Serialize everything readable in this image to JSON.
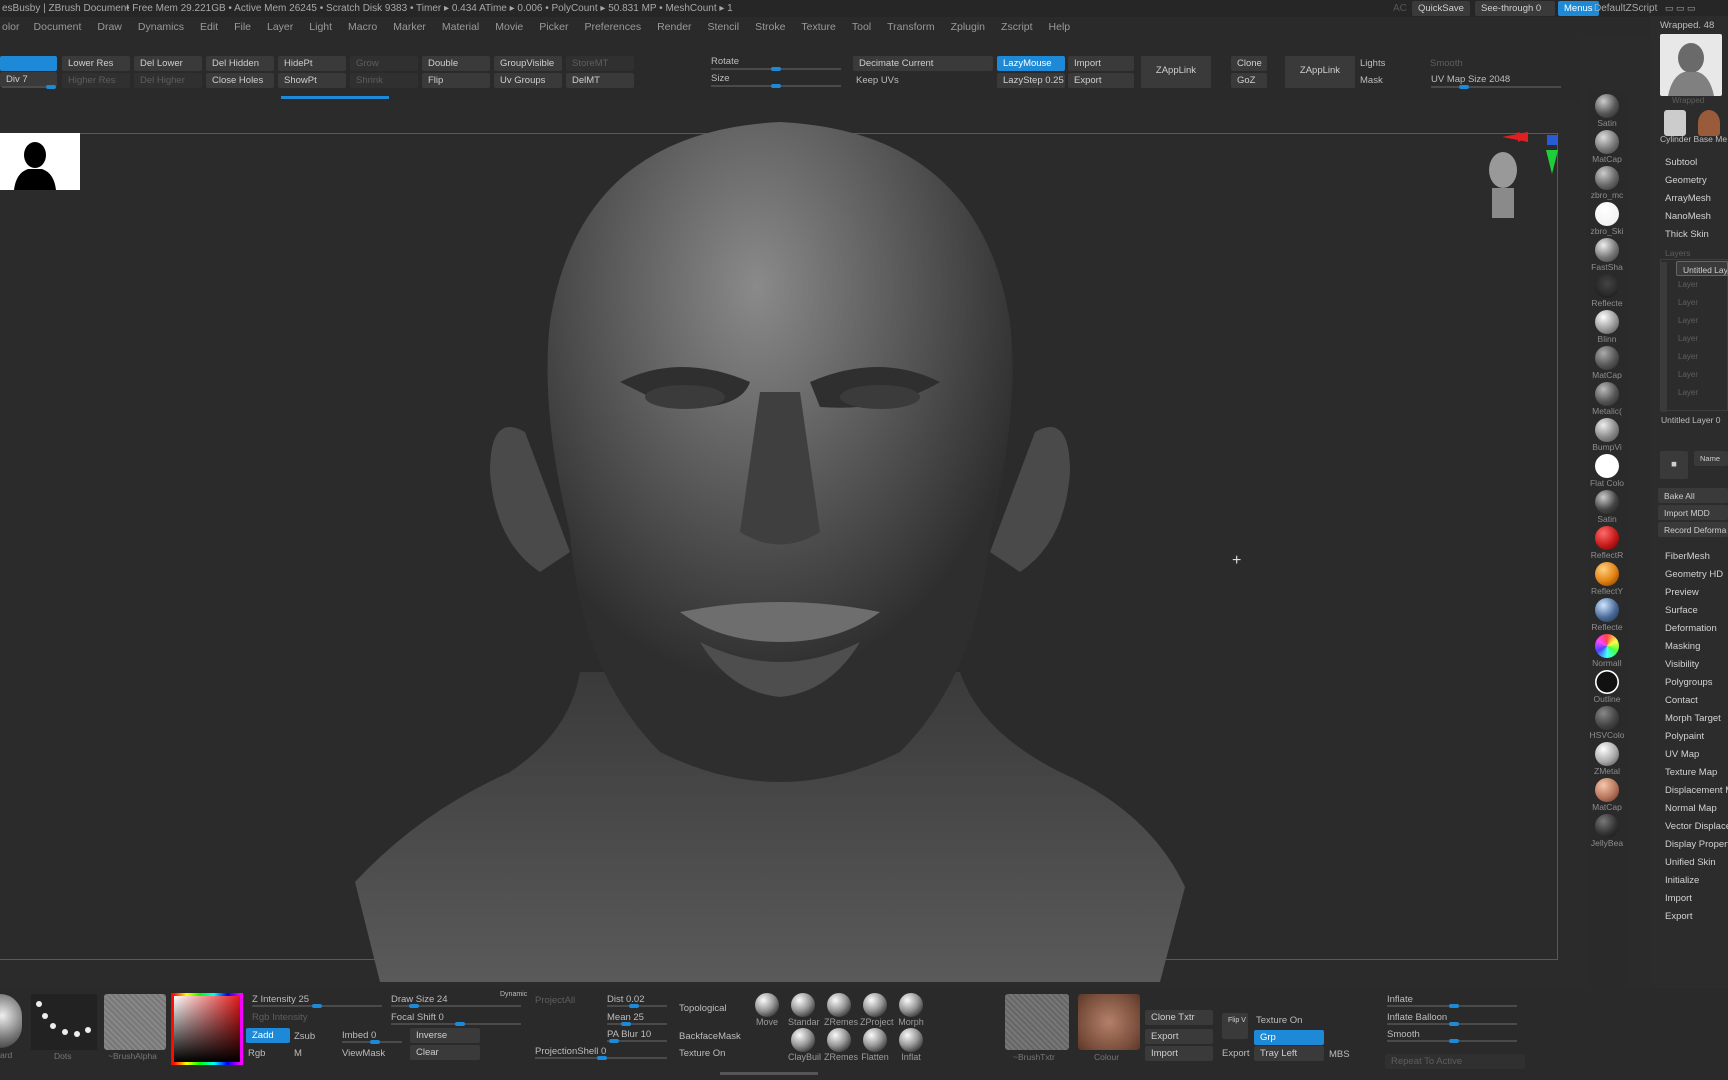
{
  "titlebar": {
    "doc": "esBusby |  ZBrush Document",
    "stats": "• Free Mem 29.221GB • Active Mem 26245 • Scratch Disk 9383 • Timer ▸ 0.434 ATime ▸ 0.006 • PolyCount ▸ 50.831 MP • MeshCount ▸ 1",
    "ac": "AC",
    "quicksave": "QuickSave",
    "seethrough": "See-through  0",
    "menus": "Menus",
    "script": "DefaultZScript"
  },
  "menubar": [
    "olor",
    "Document",
    "Draw",
    "Dynamics",
    "Edit",
    "File",
    "Layer",
    "Light",
    "Macro",
    "Marker",
    "Material",
    "Movie",
    "Picker",
    "Preferences",
    "Render",
    "Stencil",
    "Stroke",
    "Texture",
    "Tool",
    "Transform",
    "Zplugin",
    "Zscript",
    "Help"
  ],
  "topshelf": {
    "row1": [
      "Lower Res",
      "Del Lower",
      "Del Hidden",
      "HidePt",
      "Grow",
      "Double",
      "GroupVisible",
      "StoreMT"
    ],
    "row2": [
      "Higher Res",
      "Del Higher",
      "Close Holes",
      "ShowPt",
      "Shrink",
      "Flip",
      "Uv Groups",
      "DelMT"
    ],
    "div": "Div 7",
    "rotate": "Rotate",
    "size": "Size",
    "decimate": "Decimate Current",
    "keepuvs": "Keep UVs",
    "lazymouse": "LazyMouse",
    "lazystep": "LazyStep 0.25",
    "import": "Import",
    "export": "Export",
    "zapplink1": "ZAppLink",
    "clone": "Clone",
    "goz": "GoZ",
    "zapplink2": "ZAppLink",
    "lights": "Lights",
    "mask": "Mask",
    "smooth": "Smooth",
    "uvmapsize": "UV Map Size 2048"
  },
  "materials": [
    "Satin",
    "MatCap",
    "zbro_mc",
    "zbro_Ski",
    "FastSha",
    "Reflecte",
    "Blinn",
    "MatCap",
    "Metalic(",
    "BumpVi",
    "Flat Colo",
    "Satin",
    "ReflectR",
    "ReflectY",
    "Reflecte",
    "NormalI",
    "Outline",
    "HSVColo",
    "ZMetal",
    "MatCap",
    "JellyBea"
  ],
  "rightpanel": {
    "wrapped": "Wrapped. 48",
    "thumb_label": "Wrapped",
    "cyl": "Cylinder Base Me",
    "items_top": [
      "Subtool",
      "Geometry",
      "ArrayMesh",
      "NanoMesh",
      "Thick Skin"
    ],
    "layers_title": "Layers",
    "layer_name": "Untitled Lay",
    "layer_sub": [
      "Layer",
      "Layer",
      "Layer",
      "Layer",
      "Layer",
      "Layer",
      "Layer"
    ],
    "untitled_layer": "Untitled Layer 0",
    "name_btn": "Name",
    "bake": "Bake All",
    "importmdd": "Import MDD",
    "record": "Record Deforma",
    "items_bottom": [
      "FiberMesh",
      "Geometry HD",
      "Preview",
      "Surface",
      "Deformation",
      "Masking",
      "Visibility",
      "Polygroups",
      "Contact",
      "Morph Target",
      "Polypaint",
      "UV Map",
      "Texture Map",
      "Displacement M",
      "Normal Map",
      "Vector Displace",
      "Display Propert",
      "Unified Skin",
      "Initialize",
      "Import",
      "Export"
    ]
  },
  "bottomshelf": {
    "zintensity": "Z Intensity 25",
    "rgbintensity": "Rgb Intensity",
    "zadd": "Zadd",
    "zsub": "Zsub",
    "rgb": "Rgb",
    "m": "M",
    "imbed": "Imbed 0",
    "viewmask": "ViewMask",
    "inverse": "Inverse",
    "clear": "Clear",
    "drawsize": "Draw Size 24",
    "dynamic": "Dynamic",
    "focalshift": "Focal Shift 0",
    "projectall": "ProjectAll",
    "dist": "Dist 0.02",
    "mean": "Mean 25",
    "pablur": "PA Blur 10",
    "projshell": "ProjectionShell 0",
    "topological": "Topological",
    "backface": "BackfaceMask",
    "textureon1": "Texture On",
    "brushes": [
      "Move",
      "Standar",
      "ZRemes",
      "ZProject",
      "Morph",
      "ClayBuil",
      "ZRemes",
      "Flatten",
      "Inflat"
    ],
    "dots": "Dots",
    "brushalpha": "~BrushAlpha",
    "brushtxtr": "~BrushTxtr",
    "colour": "Colour",
    "clonetxtr": "Clone Txtr",
    "export": "Export",
    "import": "Import",
    "fliplbl": "Flip V",
    "textureon2": "Texture On",
    "grp": "Grp",
    "export2": "Export",
    "trayleft": "Tray Left",
    "mbs": "MBS",
    "inflate": "Inflate",
    "inflateballoon": "Inflate Balloon",
    "smooth": "Smooth",
    "repeat": "Repeat To Active",
    "brushfirst": "ard"
  },
  "colors": {
    "accent": "#1e8ad7",
    "bg": "#2b2b2b",
    "panel": "#2a2a2a"
  }
}
